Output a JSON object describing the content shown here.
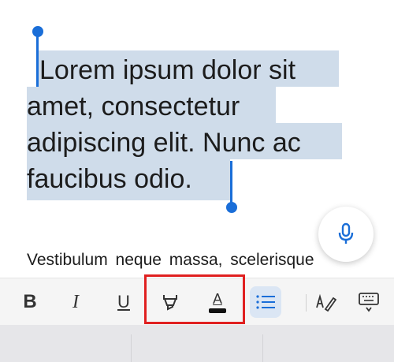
{
  "document": {
    "selected_lines": [
      "Lorem ipsum dolor sit",
      "amet, consectetur",
      "adipiscing elit. Nunc ac",
      "faucibus odio."
    ],
    "body_text": "Vestibulum neque massa, scelerisque"
  },
  "toolbar": {
    "bold_label": "B",
    "italic_label": "I",
    "underline_label": "U",
    "text_color_label": "A"
  },
  "colors": {
    "selection": "#cfdcea",
    "cursor": "#1a6ed8",
    "annotation_box": "#e02020",
    "list_active_bg": "#dbe6f4"
  }
}
